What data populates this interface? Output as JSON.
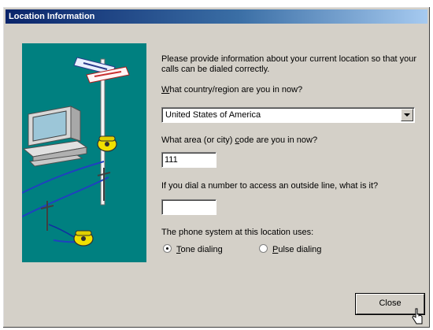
{
  "window": {
    "title": "Location Information"
  },
  "intro_text": "Please provide information about your current location so that your calls can be dialed correctly.",
  "country": {
    "label_accel": "W",
    "label_rest": "hat country/region are you in now?",
    "value": "United States of America"
  },
  "area_code": {
    "label_pre": "What area (or city) ",
    "label_accel": "c",
    "label_rest": "ode are you in now?",
    "value": "111"
  },
  "outside_line": {
    "label": "If you dial a number to access an outside line, what is it?",
    "value": ""
  },
  "phone_system": {
    "label": "The phone system at this location uses:",
    "tone": {
      "accel": "T",
      "rest": "one dialing",
      "selected": true
    },
    "pulse": {
      "accel": "P",
      "rest": "ulse dialing",
      "selected": false
    }
  },
  "buttons": {
    "close": "Close"
  },
  "colors": {
    "title_start": "#0a246a",
    "title_end": "#a6caf0",
    "illustration_bg": "#008080",
    "phone": "#f0e000"
  },
  "icons": [
    "computer-icon",
    "telephone-icon",
    "signpost-icon",
    "telephone-pole-icon",
    "mouse-pointer-icon"
  ]
}
